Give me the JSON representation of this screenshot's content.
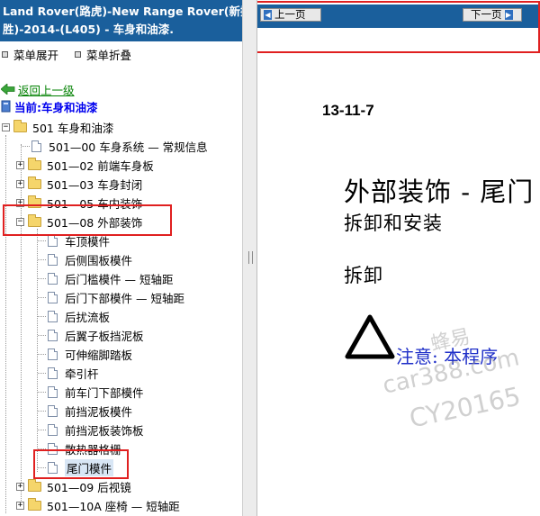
{
  "left": {
    "title_line1": "Land Rover(路虎)-New Range Rover(新揽",
    "title_line2": "胜)-2014-(L405) - 车身和油漆.",
    "menu_expand": "菜单展开",
    "menu_collapse": "菜单折叠",
    "back_label": "返回上一级",
    "current_label": "当前:车身和油漆"
  },
  "tree": {
    "root": {
      "label": "501 车身和油漆",
      "toggle": "−"
    },
    "nodes": [
      {
        "label": "501—00 车身系统 — 常规信息",
        "kind": "doc"
      },
      {
        "label": "501—02 前端车身板",
        "kind": "folder",
        "toggle": "+"
      },
      {
        "label": "501—03 车身封闭",
        "kind": "folder",
        "toggle": "+"
      },
      {
        "label": "501—05 车内装饰",
        "kind": "folder",
        "toggle": "+"
      },
      {
        "label": "501—08 外部装饰",
        "kind": "folder",
        "toggle": "−"
      }
    ],
    "children": [
      "车顶模件",
      "后侧围板模件",
      "后门槛模件 — 短轴距",
      "后门下部模件 — 短轴距",
      "后扰流板",
      "后翼子板挡泥板",
      "可伸缩脚踏板",
      "牵引杆",
      "前车门下部模件",
      "前挡泥板模件",
      "前挡泥板装饰板",
      "散热器格栅",
      "尾门模件"
    ],
    "after": [
      {
        "label": "501—09 后视镜",
        "toggle": "+"
      },
      {
        "label": "501—10A 座椅 — 短轴距",
        "toggle": "+"
      }
    ]
  },
  "doc": {
    "prev_label": "上一页",
    "next_label": "下一页",
    "number": "13-11-7",
    "title": "外部装饰 - 尾门",
    "subtitle": "拆卸和安装",
    "section": "拆卸",
    "warning": "注意:  本程序",
    "watermark_1": "蜂易",
    "watermark_2": "car388.com",
    "watermark_3": "CY20165"
  },
  "colors": {
    "header_blue": "#1a5f9c",
    "highlight_red": "#e02020",
    "link_green": "#008000",
    "warning_blue": "#1f2fc8"
  }
}
